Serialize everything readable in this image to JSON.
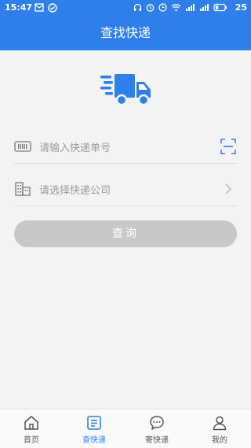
{
  "status_bar": {
    "time": "15:47",
    "battery": "25"
  },
  "header": {
    "title": "查找快递"
  },
  "form": {
    "tracking_placeholder": "请输入快递单号",
    "company_placeholder": "请选择快递公司"
  },
  "query_button": {
    "label": "查询"
  },
  "tabs": [
    {
      "label": "首页",
      "icon": "home-icon",
      "active": false
    },
    {
      "label": "查快递",
      "icon": "search-package-icon",
      "active": true
    },
    {
      "label": "寄快递",
      "icon": "chat-icon",
      "active": false
    },
    {
      "label": "我的",
      "icon": "user-icon",
      "active": false
    }
  ],
  "colors": {
    "primary": "#2f7fea",
    "button_disabled": "#c8c8c8"
  }
}
